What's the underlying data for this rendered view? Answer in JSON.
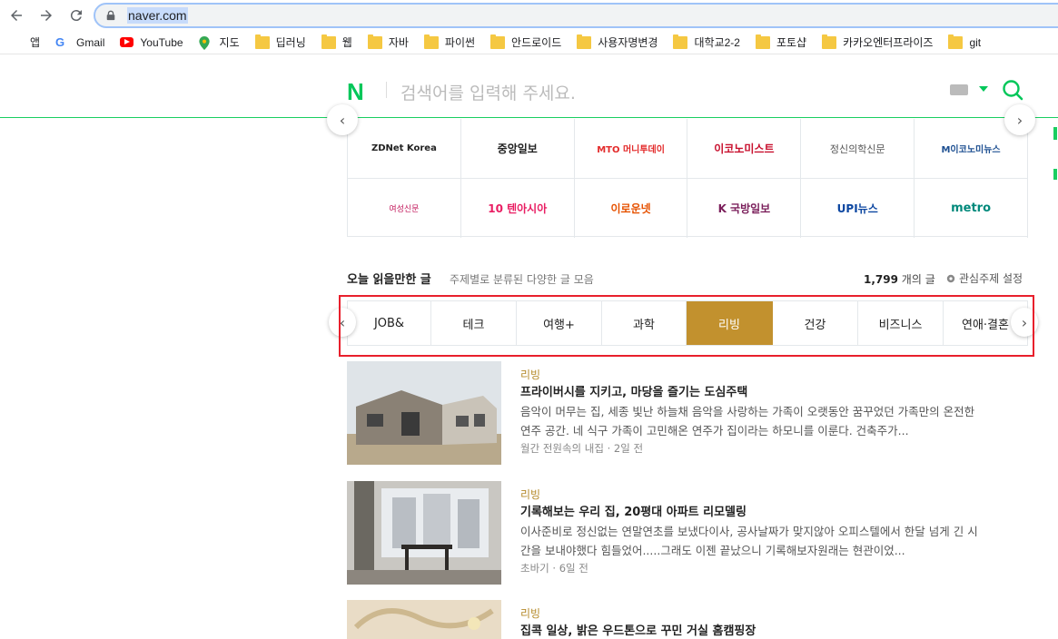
{
  "browser": {
    "url": "naver.com",
    "bookmarks": [
      "앱",
      "Gmail",
      "YouTube",
      "지도",
      "딥러닝",
      "웹",
      "자바",
      "파이썬",
      "안드로이드",
      "사용자명변경",
      "대학교2-2",
      "포토샵",
      "카카오엔터프라이즈",
      "git"
    ]
  },
  "search": {
    "logo": "N",
    "placeholder": "검색어를 입력해 주세요."
  },
  "press": {
    "row1": [
      "ZDNet Korea",
      "중앙일보",
      "MTO 머니투데이",
      "이코노미스트",
      "정신의학신문",
      "M이코노미뉴스"
    ],
    "row2": [
      "여성신문",
      "10 텐아시아",
      "이로운넷",
      "K 국방일보",
      "UPI뉴스",
      "metro"
    ]
  },
  "section": {
    "title": "오늘 읽을만한 글",
    "subtitle": "주제별로 분류된 다양한 글 모음",
    "count_num": "1,799",
    "count_suffix": "개의 글",
    "settings_label": "관심주제 설정"
  },
  "tabs": [
    "JOB&",
    "테크",
    "여행+",
    "과학",
    "리빙",
    "건강",
    "비즈니스",
    "연애·결혼"
  ],
  "active_tab": "리빙",
  "articles": [
    {
      "category": "리빙",
      "title": "프라이버시를 지키고, 마당을 즐기는 도심주택",
      "body": "음악이 머무는 집, 세종 빛난 하늘채 음악을 사랑하는 가족이 오랫동안 꿈꾸었던 가족만의 온전한 연주 공간. 네 식구 가족이 고민해온 연주가 집이라는 하모니를 이룬다. 건축주가...",
      "meta": "월간 전원속의 내집 · 2일 전"
    },
    {
      "category": "리빙",
      "title": "기록해보는 우리 집, 20평대 아파트 리모델링",
      "body": "이사준비로 정신없는 연말연초를 보냈다이사, 공사날짜가 맞지않아 오피스텔에서 한달 넘게 긴 시간을 보내야했다 힘들었어.....그래도 이젠 끝났으니 기록해보자원래는 현관이었...",
      "meta": "초바기 · 6일 전"
    },
    {
      "category": "리빙",
      "title": "집콕 일상, 밝은 우드톤으로 꾸민 거실 홈캠핑장",
      "body": "",
      "meta": ""
    }
  ],
  "colors": {
    "naver_green": "#03c75a",
    "active_tab": "#c2912e",
    "highlight": "#e8202c",
    "category": "#b58a2a"
  }
}
